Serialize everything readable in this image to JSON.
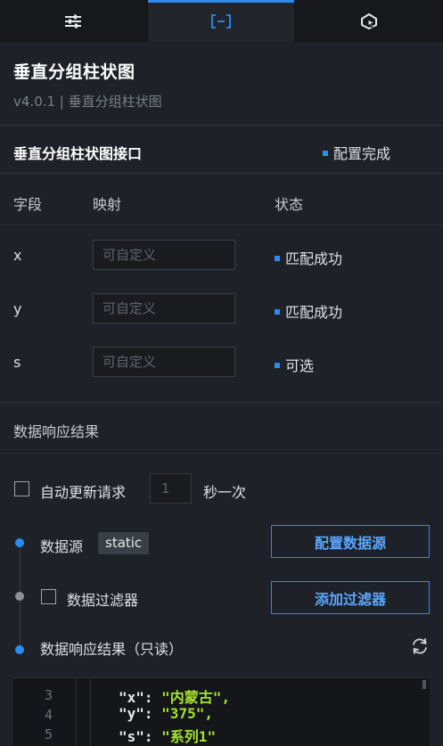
{
  "tabs": [
    {
      "name": "sliders-icon",
      "active": false
    },
    {
      "name": "data-bracket-icon",
      "active": true
    },
    {
      "name": "interaction-icon",
      "active": false
    }
  ],
  "header": {
    "title": "垂直分组柱状图",
    "subtitle": "v4.0.1 | 垂直分组柱状图"
  },
  "interface": {
    "title": "垂直分组柱状图接口",
    "status": "配置完成"
  },
  "mapping": {
    "col_field": "字段",
    "col_map": "映射",
    "col_status": "状态",
    "rows": [
      {
        "field": "x",
        "placeholder": "可自定义",
        "status": "匹配成功"
      },
      {
        "field": "y",
        "placeholder": "可自定义",
        "status": "匹配成功"
      },
      {
        "field": "s",
        "placeholder": "可自定义",
        "status": "可选"
      }
    ]
  },
  "response": {
    "title": "数据响应结果",
    "auto_update_label": "自动更新请求",
    "interval_value": "1",
    "interval_unit": "秒一次",
    "source_label": "数据源",
    "source_tag": "static",
    "config_source_btn": "配置数据源",
    "filter_label": "数据过滤器",
    "add_filter_btn": "添加过滤器",
    "result_label": "数据响应结果（只读）"
  },
  "code": {
    "lines": [
      {
        "n": "3",
        "key": "\"x\"",
        "val": "\"内蒙古\","
      },
      {
        "n": "4",
        "key": "\"y\"",
        "val": "\"375\","
      },
      {
        "n": "5",
        "key": "\"s\"",
        "val": "\"系列1\""
      }
    ]
  },
  "colors": {
    "accent": "#2b8cf0",
    "string": "#a6e22e"
  }
}
